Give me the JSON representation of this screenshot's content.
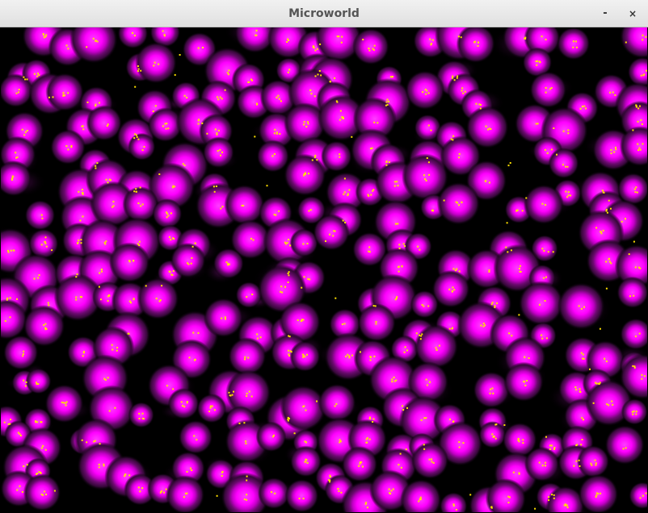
{
  "window": {
    "title": "Microworld",
    "minimize_glyph": "-",
    "close_glyph": "×"
  },
  "simulation": {
    "background_color": "#000000",
    "blob_core_color": "#ff00ff",
    "blob_halo_color": "#7a0d7a",
    "particle_color": "#ffe100"
  }
}
